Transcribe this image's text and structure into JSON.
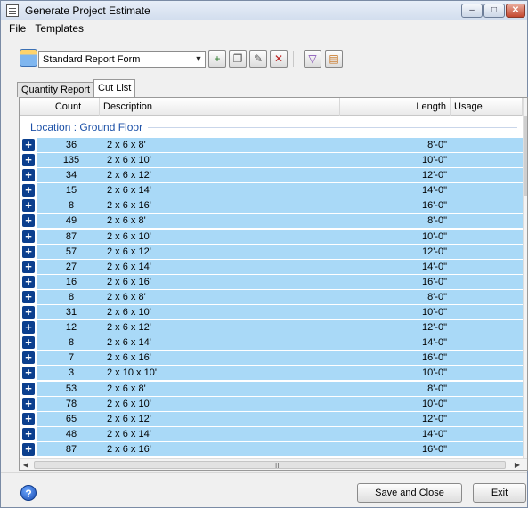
{
  "window": {
    "title": "Generate Project Estimate",
    "controls": [
      "–",
      "□",
      "✕"
    ]
  },
  "menu": {
    "file": "File",
    "templates": "Templates"
  },
  "toolbar": {
    "combo_value": "Standard Report Form",
    "buttons": [
      "add-template-icon",
      "copy-template-icon",
      "edit-template-icon",
      "delete-template-icon",
      "filter-icon",
      "sort-icon"
    ]
  },
  "tabs": {
    "quantity_report": "Quantity Report",
    "cut_list": "Cut List"
  },
  "grid": {
    "headers": {
      "count": "Count",
      "description": "Description",
      "length": "Length",
      "usage": "Usage"
    },
    "location": "Location : Ground Floor",
    "rows": [
      {
        "count": "36",
        "description": "2 x 6 x 8'",
        "length": "8'-0\""
      },
      {
        "count": "135",
        "description": "2 x 6 x 10'",
        "length": "10'-0\""
      },
      {
        "count": "34",
        "description": "2 x 6 x 12'",
        "length": "12'-0\""
      },
      {
        "count": "15",
        "description": "2 x 6 x 14'",
        "length": "14'-0\""
      },
      {
        "count": "8",
        "description": "2 x 6 x 16'",
        "length": "16'-0\""
      },
      {
        "count": "49",
        "description": "2 x 6 x 8'",
        "length": "8'-0\""
      },
      {
        "count": "87",
        "description": "2 x 6 x 10'",
        "length": "10'-0\""
      },
      {
        "count": "57",
        "description": "2 x 6 x 12'",
        "length": "12'-0\""
      },
      {
        "count": "27",
        "description": "2 x 6 x 14'",
        "length": "14'-0\""
      },
      {
        "count": "16",
        "description": "2 x 6 x 16'",
        "length": "16'-0\""
      },
      {
        "count": "8",
        "description": "2 x 6 x 8'",
        "length": "8'-0\""
      },
      {
        "count": "31",
        "description": "2 x 6 x 10'",
        "length": "10'-0\""
      },
      {
        "count": "12",
        "description": "2 x 6 x 12'",
        "length": "12'-0\""
      },
      {
        "count": "8",
        "description": "2 x 6 x 14'",
        "length": "14'-0\""
      },
      {
        "count": "7",
        "description": "2 x 6 x 16'",
        "length": "16'-0\""
      },
      {
        "count": "3",
        "description": "2 x 10 x 10'",
        "length": "10'-0\""
      },
      {
        "count": "53",
        "description": "2 x 6 x 8'",
        "length": "8'-0\""
      },
      {
        "count": "78",
        "description": "2 x 6 x 10'",
        "length": "10'-0\""
      },
      {
        "count": "65",
        "description": "2 x 6 x 12'",
        "length": "12'-0\""
      },
      {
        "count": "48",
        "description": "2 x 6 x 14'",
        "length": "14'-0\""
      },
      {
        "count": "87",
        "description": "2 x 6 x 16'",
        "length": "16'-0\""
      }
    ],
    "scroll_grip": "III"
  },
  "footer": {
    "help": "?",
    "save_close": "Save and Close",
    "exit": "Exit"
  },
  "colors": {
    "row_highlight": "#a9d9f7",
    "expand_button": "#0b3f8e",
    "location_text": "#1e52a8"
  }
}
